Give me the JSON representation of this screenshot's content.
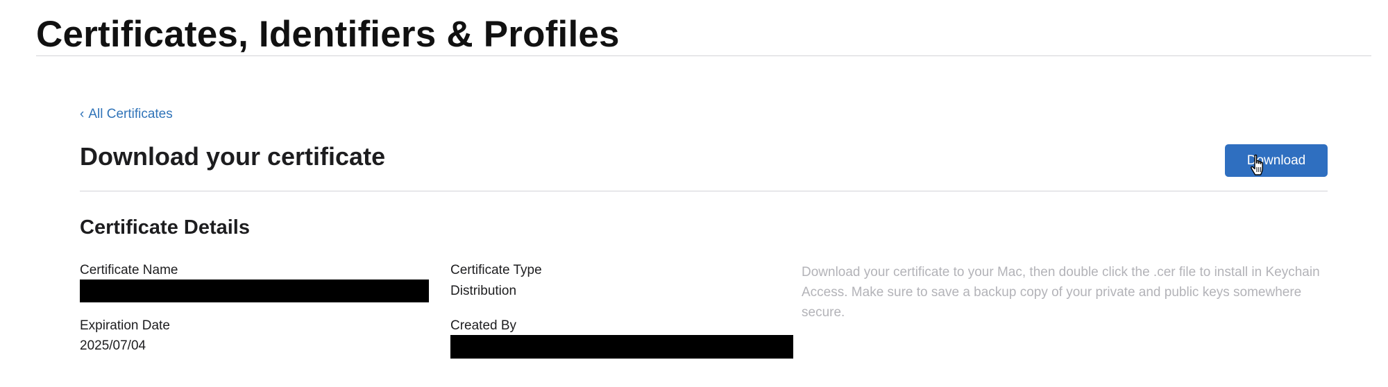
{
  "header": {
    "title": "Certificates, Identifiers & Profiles"
  },
  "nav": {
    "back_chevron": "‹",
    "back_label": "All Certificates"
  },
  "main": {
    "title": "Download your certificate",
    "download_label": "Download"
  },
  "details": {
    "title": "Certificate Details",
    "certificate_name_label": "Certificate Name",
    "certificate_type_label": "Certificate Type",
    "certificate_type_value": "Distribution",
    "expiration_date_label": "Expiration Date",
    "expiration_date_value": "2025/07/04",
    "created_by_label": "Created By",
    "info_text": "Download your certificate to your Mac, then double click the .cer file to install in Keychain Access. Make sure to save a backup copy of your private and public keys somewhere secure."
  },
  "colors": {
    "link": "#2f73b8",
    "button": "#2f6fc0",
    "muted_text": "#b3b3b8"
  },
  "icons": {
    "cursor": "hand-pointer-icon"
  }
}
